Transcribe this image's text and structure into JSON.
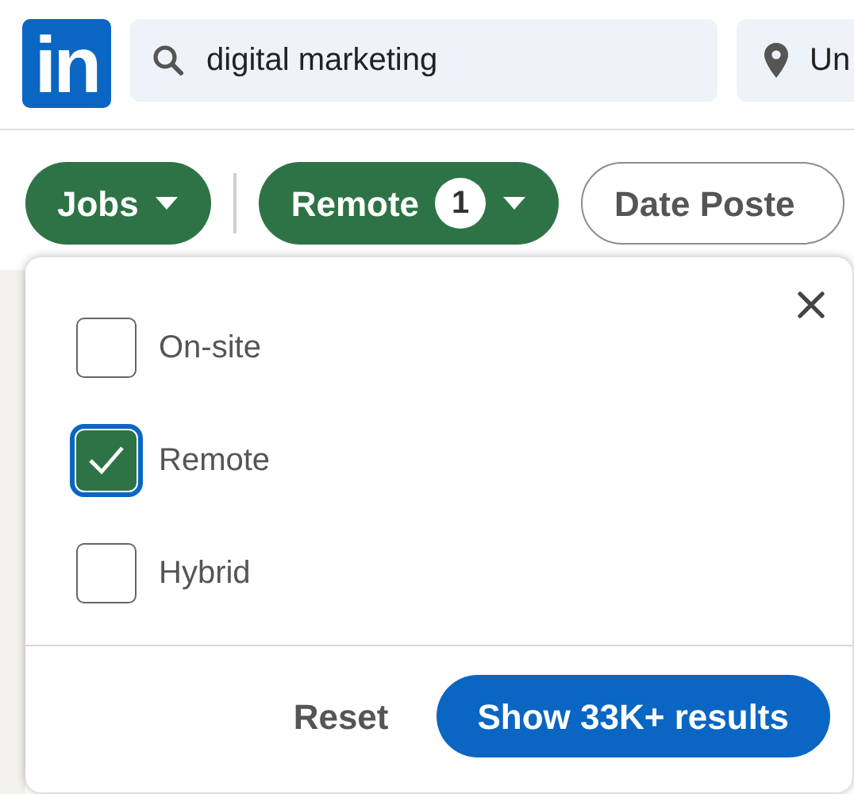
{
  "logo": {
    "text": "in"
  },
  "search": {
    "value": "digital marketing"
  },
  "location": {
    "value": "Un"
  },
  "filters": [
    {
      "label": "Jobs",
      "selected": true
    },
    {
      "label": "Remote",
      "selected": true,
      "badge": "1"
    },
    {
      "label": "Date Poste",
      "selected": false
    }
  ],
  "popup": {
    "options": [
      {
        "label": "On-site",
        "checked": false
      },
      {
        "label": "Remote",
        "checked": true,
        "focused": true
      },
      {
        "label": "Hybrid",
        "checked": false
      }
    ],
    "reset": "Reset",
    "submit": "Show 33K+ results"
  }
}
